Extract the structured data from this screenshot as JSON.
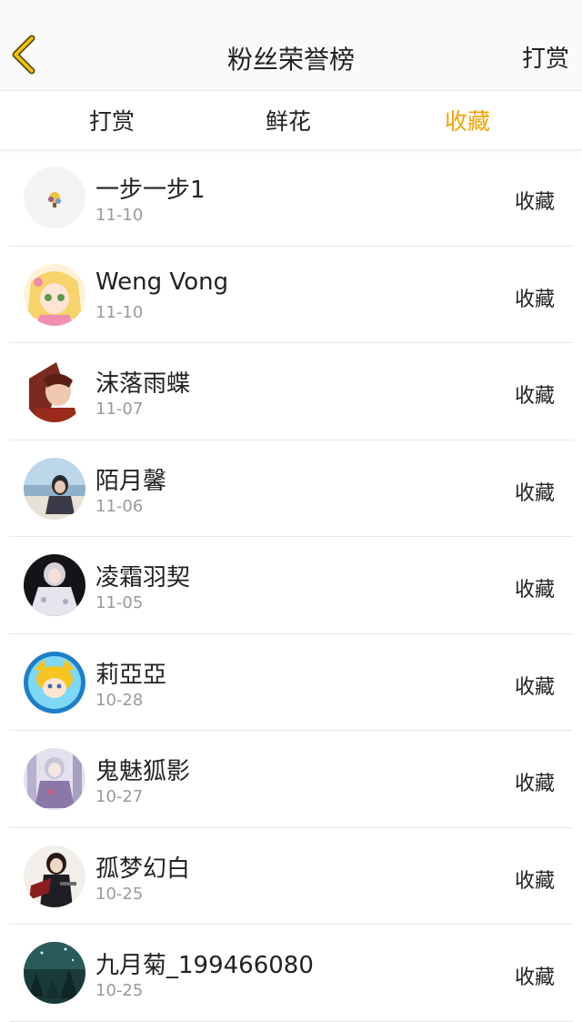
{
  "header": {
    "title": "粉丝荣誉榜",
    "right_action": "打赏",
    "back_icon": "chevron-left-icon",
    "accent_color": "#f5a300"
  },
  "tabs": [
    {
      "label": "打赏",
      "active": false
    },
    {
      "label": "鲜花",
      "active": false
    },
    {
      "label": "收藏",
      "active": true
    }
  ],
  "list": [
    {
      "name": "一步一步1",
      "date": "11-10",
      "type": "收藏"
    },
    {
      "name": "Weng Vong",
      "date": "11-10",
      "type": "收藏"
    },
    {
      "name": "沫落雨蝶",
      "date": "11-07",
      "type": "收藏"
    },
    {
      "name": "陌月馨",
      "date": "11-06",
      "type": "收藏"
    },
    {
      "name": "凌霜羽契",
      "date": "11-05",
      "type": "收藏"
    },
    {
      "name": "莉亞亞",
      "date": "10-28",
      "type": "收藏"
    },
    {
      "name": "鬼魅狐影",
      "date": "10-27",
      "type": "收藏"
    },
    {
      "name": "孤梦幻白",
      "date": "10-25",
      "type": "收藏"
    },
    {
      "name": "九月菊_199466080",
      "date": "10-25",
      "type": "收藏"
    }
  ]
}
